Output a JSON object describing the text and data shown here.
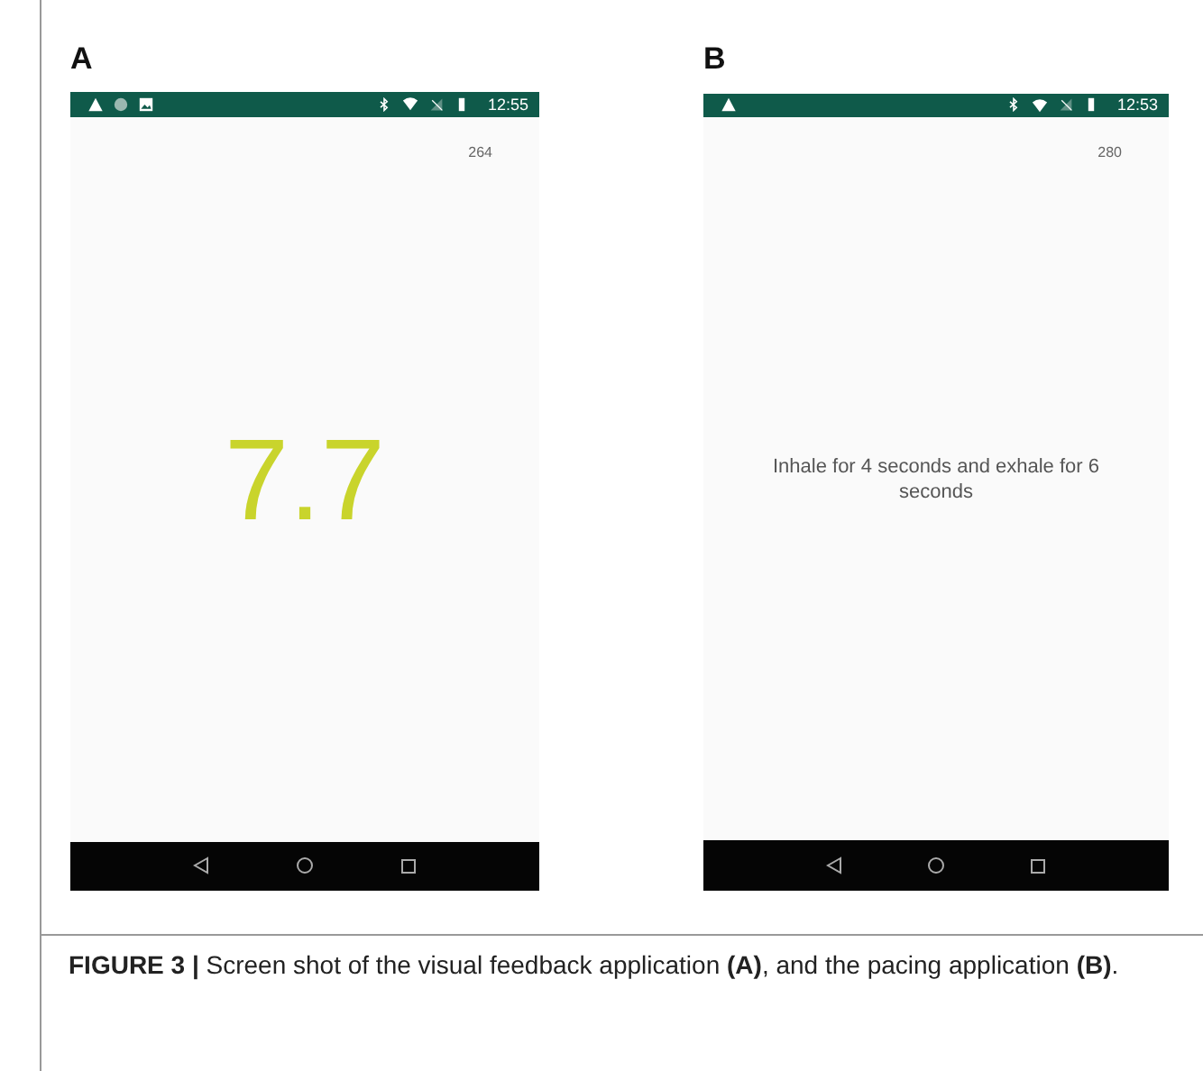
{
  "panels": [
    {
      "label": "A",
      "status_bar": {
        "notifications": [
          {
            "kind": "warning"
          },
          {
            "kind": "dot"
          },
          {
            "kind": "image"
          }
        ],
        "time": "12:55"
      },
      "counter": "264",
      "content": {
        "kind": "score",
        "text": "7.7",
        "color": "#c9d42c"
      }
    },
    {
      "label": "B",
      "status_bar": {
        "notifications": [
          {
            "kind": "warning"
          }
        ],
        "time": "12:53"
      },
      "counter": "280",
      "content": {
        "kind": "message",
        "text": "Inhale for 4 seconds and exhale for 6 seconds"
      }
    }
  ],
  "caption": "**FIGURE 3 |** Screen shot of the visual feedback application **(A)**, and the pacing application **(B)**."
}
